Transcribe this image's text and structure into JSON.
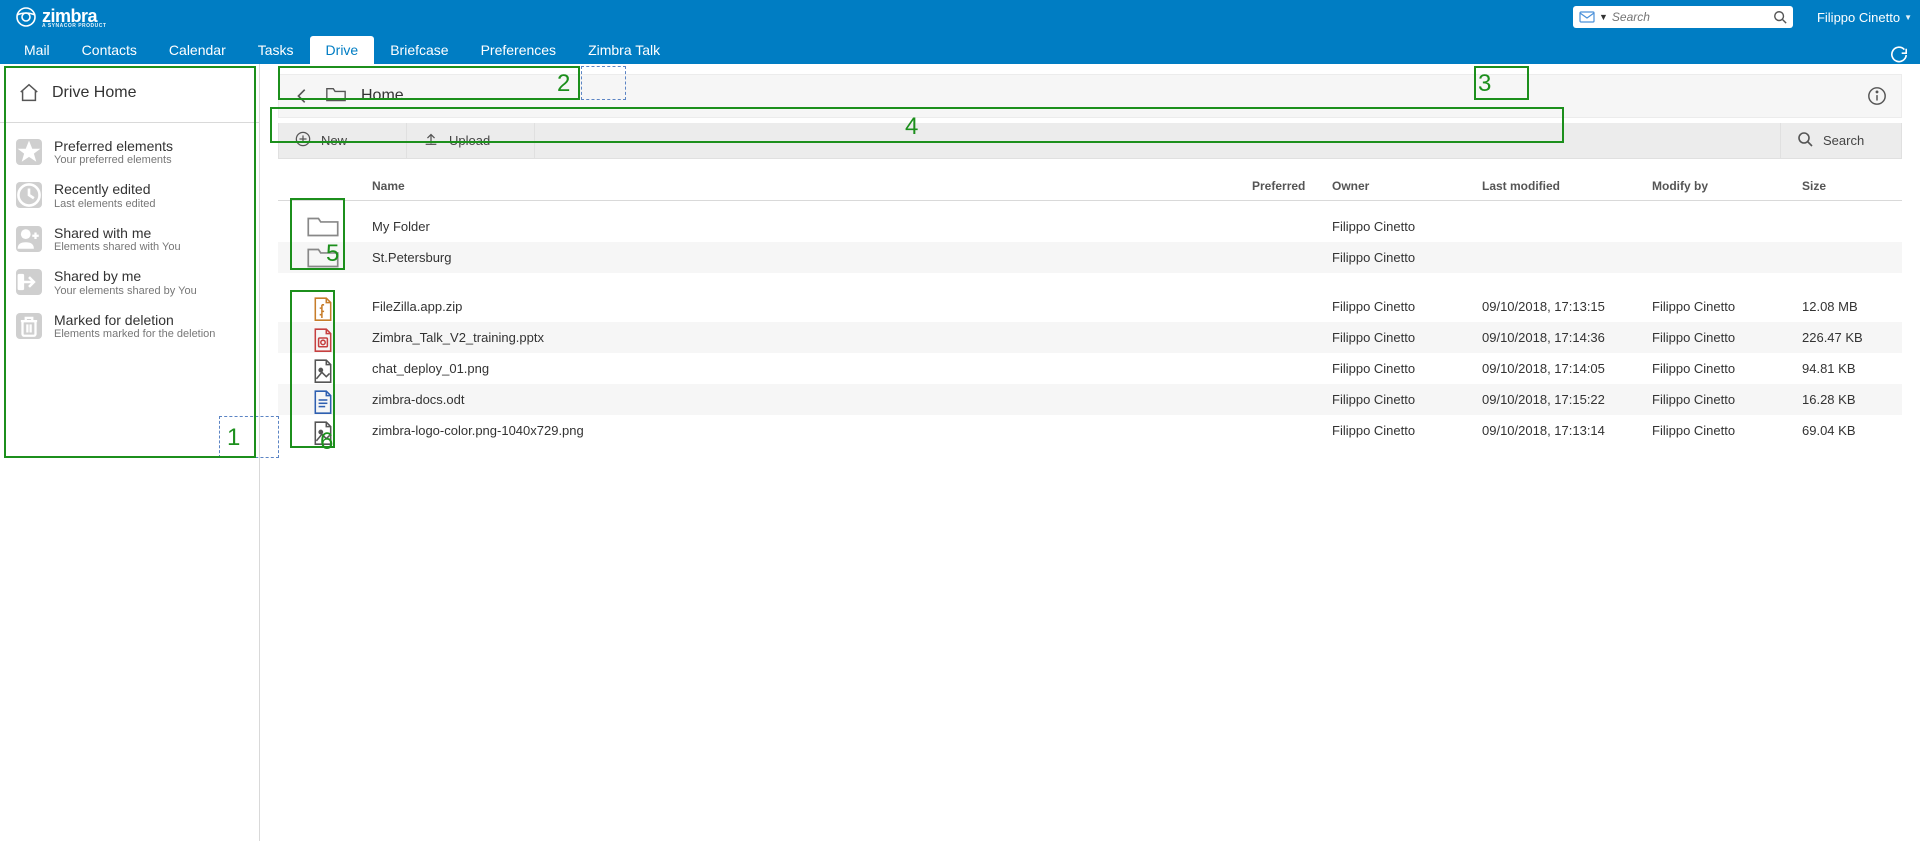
{
  "header": {
    "product_name": "zimbra",
    "product_tagline": "A SYNACOR PRODUCT",
    "search_placeholder": "Search",
    "user_name": "Filippo Cinetto"
  },
  "tabs": [
    "Mail",
    "Contacts",
    "Calendar",
    "Tasks",
    "Drive",
    "Briefcase",
    "Preferences",
    "Zimbra Talk"
  ],
  "active_tab_index": 4,
  "sidebar": {
    "title": "Drive Home",
    "items": [
      {
        "label": "Preferred elements",
        "sublabel": "Your preferred elements",
        "icon": "star"
      },
      {
        "label": "Recently edited",
        "sublabel": "Last elements edited",
        "icon": "clock"
      },
      {
        "label": "Shared with me",
        "sublabel": "Elements shared with You",
        "icon": "user-plus"
      },
      {
        "label": "Shared by me",
        "sublabel": "Your elements shared by You",
        "icon": "share"
      },
      {
        "label": "Marked for deletion",
        "sublabel": "Elements marked for the deletion",
        "icon": "trash"
      }
    ]
  },
  "breadcrumb": {
    "label": "Home"
  },
  "toolbar": {
    "new_label": "New",
    "upload_label": "Upload",
    "search_label": "Search"
  },
  "table": {
    "headers": {
      "name": "Name",
      "preferred": "Preferred",
      "owner": "Owner",
      "modified": "Last modified",
      "modby": "Modify by",
      "size": "Size"
    },
    "folders": [
      {
        "name": "My Folder",
        "owner": "Filippo Cinetto",
        "modified": "",
        "modby": "",
        "size": ""
      },
      {
        "name": "St.Petersburg",
        "owner": "Filippo Cinetto",
        "modified": "",
        "modby": "",
        "size": ""
      }
    ],
    "files": [
      {
        "icon": "zip",
        "name": "FileZilla.app.zip",
        "owner": "Filippo Cinetto",
        "modified": "09/10/2018, 17:13:15",
        "modby": "Filippo Cinetto",
        "size": "12.08 MB"
      },
      {
        "icon": "pptx",
        "name": "Zimbra_Talk_V2_training.pptx",
        "owner": "Filippo Cinetto",
        "modified": "09/10/2018, 17:14:36",
        "modby": "Filippo Cinetto",
        "size": "226.47 KB"
      },
      {
        "icon": "png",
        "name": "chat_deploy_01.png",
        "owner": "Filippo Cinetto",
        "modified": "09/10/2018, 17:14:05",
        "modby": "Filippo Cinetto",
        "size": "94.81 KB"
      },
      {
        "icon": "odt",
        "name": "zimbra-docs.odt",
        "owner": "Filippo Cinetto",
        "modified": "09/10/2018, 17:15:22",
        "modby": "Filippo Cinetto",
        "size": "16.28 KB"
      },
      {
        "icon": "png",
        "name": "zimbra-logo-color.png-1040x729.png",
        "owner": "Filippo Cinetto",
        "modified": "09/10/2018, 17:13:14",
        "modby": "Filippo Cinetto",
        "size": "69.04 KB"
      }
    ]
  },
  "annotations": [
    "1",
    "2",
    "3",
    "4",
    "5",
    "6"
  ]
}
